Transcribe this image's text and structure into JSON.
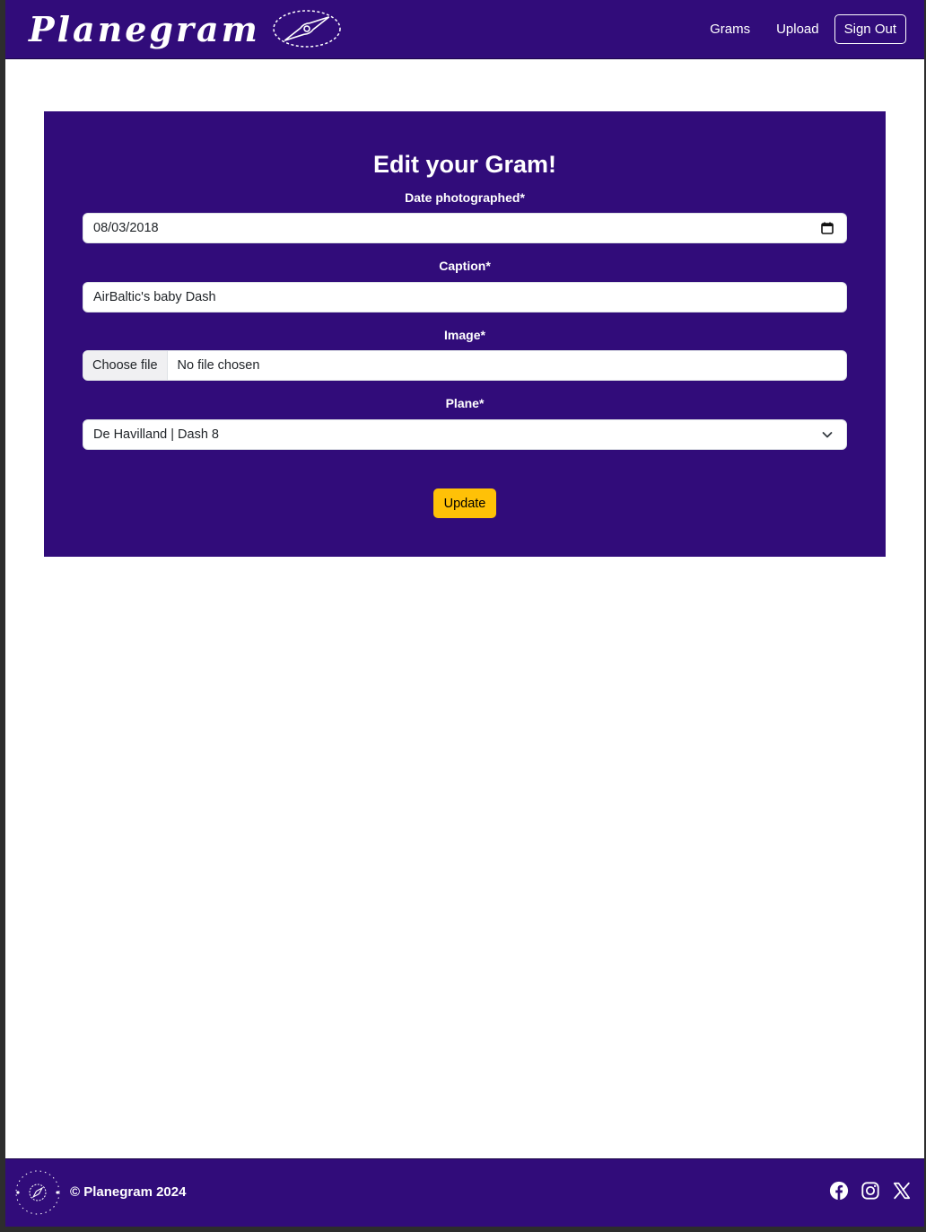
{
  "header": {
    "brand": "Planegram",
    "nav": {
      "grams": "Grams",
      "upload": "Upload",
      "sign_out": "Sign Out"
    }
  },
  "form": {
    "title": "Edit your Gram!",
    "date": {
      "label": "Date photographed*",
      "value": "08/03/2018",
      "icon": "calendar-icon"
    },
    "caption": {
      "label": "Caption*",
      "value": "AirBaltic's baby Dash"
    },
    "image": {
      "label": "Image*",
      "button": "Choose file",
      "status": "No file chosen"
    },
    "plane": {
      "label": "Plane*",
      "selected": "De Havilland | Dash 8",
      "icon": "chevron-down-icon"
    },
    "submit": "Update"
  },
  "footer": {
    "copyright": "© Planegram 2024",
    "logo_text": "Planegram",
    "socials": [
      "facebook-icon",
      "instagram-icon",
      "x-icon"
    ]
  },
  "colors": {
    "brand_purple": "#310c7a",
    "accent_yellow": "#ffc107",
    "white": "#ffffff"
  }
}
